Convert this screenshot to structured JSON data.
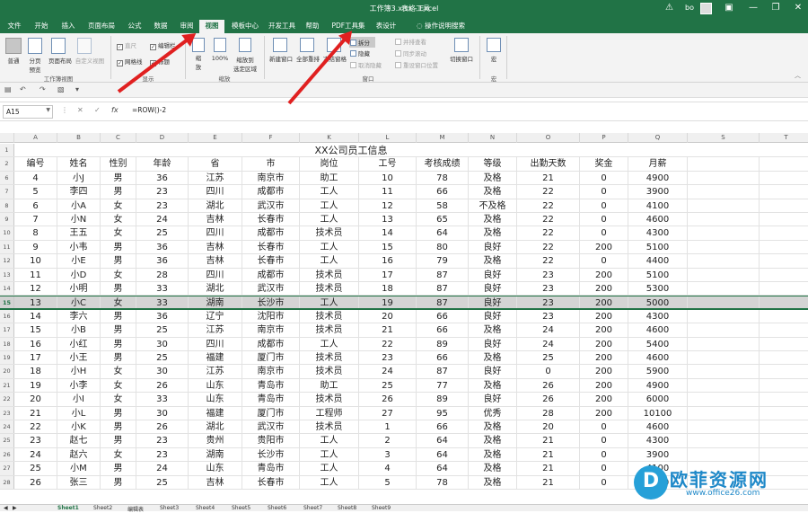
{
  "titlebar": {
    "title": "工作簿3.xlsx - Excel",
    "table_tools": "表格工具",
    "user": "bo",
    "warn_icon": "warning-icon",
    "min": "—",
    "restore": "❐",
    "close": "✕",
    "color": "#217346"
  },
  "tabs": [
    "文件",
    "开始",
    "插入",
    "页面布局",
    "公式",
    "数据",
    "审阅",
    "视图",
    "模板中心",
    "开发工具",
    "帮助",
    "PDF工具集",
    "表设计",
    "操作说明搜索"
  ],
  "active_tab": "视图",
  "ribbon": {
    "normal": "普通",
    "page_break": "分页\n预览",
    "page_layout": "页面布局",
    "custom_view": "自定义视图",
    "workbook_views": "工作簿视图",
    "ruler": "直尺",
    "formula_bar": "编辑栏",
    "gridlines": "网格线",
    "headings": "标题",
    "show": "显示",
    "zoom": "缩\n放",
    "zoom100": "100%",
    "zoom_sel": "缩放到\n选定区域",
    "zoom_group": "缩放",
    "new_window": "新建窗口",
    "arrange_all": "全部重排",
    "freeze": "冻结窗格",
    "split": "拆分",
    "hide": "隐藏",
    "unhide": "取消隐藏",
    "side_by_side": "并排查看",
    "sync_scroll": "同步滚动",
    "reset_pos": "重设窗口位置",
    "switch_window": "切换窗口",
    "window_group": "窗口",
    "macro": "宏",
    "macro_group": "宏"
  },
  "namebox": "A15",
  "formula": "=ROW()-2",
  "fx_label": "fx",
  "columns": [
    "A",
    "B",
    "C",
    "D",
    "E",
    "F",
    "K",
    "L",
    "M",
    "N",
    "O",
    "P",
    "Q",
    "S",
    "T"
  ],
  "sheet_title": "XX公司员工信息",
  "headers": [
    "编号",
    "姓名",
    "性别",
    "年龄",
    "省",
    "市",
    "岗位",
    "工号",
    "考核成绩",
    "等级",
    "出勤天数",
    "奖金",
    "月薪"
  ],
  "rows": [
    {
      "r": "6",
      "v": [
        "4",
        "小J",
        "男",
        "36",
        "江苏",
        "南京市",
        "助工",
        "10",
        "78",
        "及格",
        "21",
        "0",
        "4900"
      ]
    },
    {
      "r": "7",
      "v": [
        "5",
        "李四",
        "男",
        "23",
        "四川",
        "成都市",
        "工人",
        "11",
        "66",
        "及格",
        "22",
        "0",
        "3900"
      ]
    },
    {
      "r": "8",
      "v": [
        "6",
        "小A",
        "女",
        "23",
        "湖北",
        "武汉市",
        "工人",
        "12",
        "58",
        "不及格",
        "22",
        "0",
        "4100"
      ]
    },
    {
      "r": "9",
      "v": [
        "7",
        "小N",
        "女",
        "24",
        "吉林",
        "长春市",
        "工人",
        "13",
        "65",
        "及格",
        "22",
        "0",
        "4600"
      ]
    },
    {
      "r": "10",
      "v": [
        "8",
        "王五",
        "女",
        "25",
        "四川",
        "成都市",
        "技术员",
        "14",
        "64",
        "及格",
        "22",
        "0",
        "4300"
      ]
    },
    {
      "r": "11",
      "v": [
        "9",
        "小韦",
        "男",
        "36",
        "吉林",
        "长春市",
        "工人",
        "15",
        "80",
        "良好",
        "22",
        "200",
        "5100"
      ]
    },
    {
      "r": "12",
      "v": [
        "10",
        "小E",
        "男",
        "36",
        "吉林",
        "长春市",
        "工人",
        "16",
        "79",
        "及格",
        "22",
        "0",
        "4400"
      ]
    },
    {
      "r": "13",
      "v": [
        "11",
        "小D",
        "女",
        "28",
        "四川",
        "成都市",
        "技术员",
        "17",
        "87",
        "良好",
        "23",
        "200",
        "5100"
      ]
    },
    {
      "r": "14",
      "v": [
        "12",
        "小明",
        "男",
        "33",
        "湖北",
        "武汉市",
        "技术员",
        "18",
        "87",
        "良好",
        "23",
        "200",
        "5300"
      ]
    },
    {
      "r": "15",
      "v": [
        "13",
        "小C",
        "女",
        "33",
        "湖南",
        "长沙市",
        "工人",
        "19",
        "87",
        "良好",
        "23",
        "200",
        "5000"
      ],
      "sel": true
    },
    {
      "r": "16",
      "v": [
        "14",
        "李六",
        "男",
        "36",
        "辽宁",
        "沈阳市",
        "技术员",
        "20",
        "66",
        "良好",
        "23",
        "200",
        "4300"
      ]
    },
    {
      "r": "17",
      "v": [
        "15",
        "小B",
        "男",
        "25",
        "江苏",
        "南京市",
        "技术员",
        "21",
        "66",
        "及格",
        "24",
        "200",
        "4600"
      ]
    },
    {
      "r": "18",
      "v": [
        "16",
        "小红",
        "男",
        "30",
        "四川",
        "成都市",
        "工人",
        "22",
        "89",
        "良好",
        "24",
        "200",
        "5400"
      ]
    },
    {
      "r": "19",
      "v": [
        "17",
        "小王",
        "男",
        "25",
        "福建",
        "厦门市",
        "技术员",
        "23",
        "66",
        "及格",
        "25",
        "200",
        "4600"
      ]
    },
    {
      "r": "20",
      "v": [
        "18",
        "小H",
        "女",
        "30",
        "江苏",
        "南京市",
        "技术员",
        "24",
        "87",
        "良好",
        "0",
        "200",
        "5900"
      ]
    },
    {
      "r": "21",
      "v": [
        "19",
        "小李",
        "女",
        "26",
        "山东",
        "青岛市",
        "助工",
        "25",
        "77",
        "及格",
        "26",
        "200",
        "4900"
      ]
    },
    {
      "r": "22",
      "v": [
        "20",
        "小I",
        "女",
        "33",
        "山东",
        "青岛市",
        "技术员",
        "26",
        "89",
        "良好",
        "26",
        "200",
        "6000"
      ]
    },
    {
      "r": "23",
      "v": [
        "21",
        "小L",
        "男",
        "30",
        "福建",
        "厦门市",
        "工程师",
        "27",
        "95",
        "优秀",
        "28",
        "200",
        "10100"
      ]
    },
    {
      "r": "24",
      "v": [
        "22",
        "小K",
        "男",
        "26",
        "湖北",
        "武汉市",
        "技术员",
        "1",
        "66",
        "及格",
        "20",
        "0",
        "4600"
      ]
    },
    {
      "r": "25",
      "v": [
        "23",
        "赵七",
        "男",
        "23",
        "贵州",
        "贵阳市",
        "工人",
        "2",
        "64",
        "及格",
        "21",
        "0",
        "4300"
      ]
    },
    {
      "r": "26",
      "v": [
        "24",
        "赵六",
        "女",
        "23",
        "湖南",
        "长沙市",
        "工人",
        "3",
        "64",
        "及格",
        "21",
        "0",
        "3900"
      ]
    },
    {
      "r": "27",
      "v": [
        "25",
        "小M",
        "男",
        "24",
        "山东",
        "青岛市",
        "工人",
        "4",
        "64",
        "及格",
        "21",
        "0",
        "4100"
      ]
    },
    {
      "r": "28",
      "v": [
        "26",
        "张三",
        "男",
        "25",
        "吉林",
        "长春市",
        "工人",
        "5",
        "78",
        "及格",
        "21",
        "0",
        "4800"
      ]
    }
  ],
  "sheets": [
    "Sheet1",
    "Sheet2",
    "编辑表",
    "Sheet3",
    "Sheet4",
    "Sheet5",
    "Sheet6",
    "Sheet7",
    "Sheet8",
    "Sheet9"
  ],
  "watermark": {
    "brand": "欧菲资源网",
    "url": "www.office26.com",
    "logo": "D"
  }
}
